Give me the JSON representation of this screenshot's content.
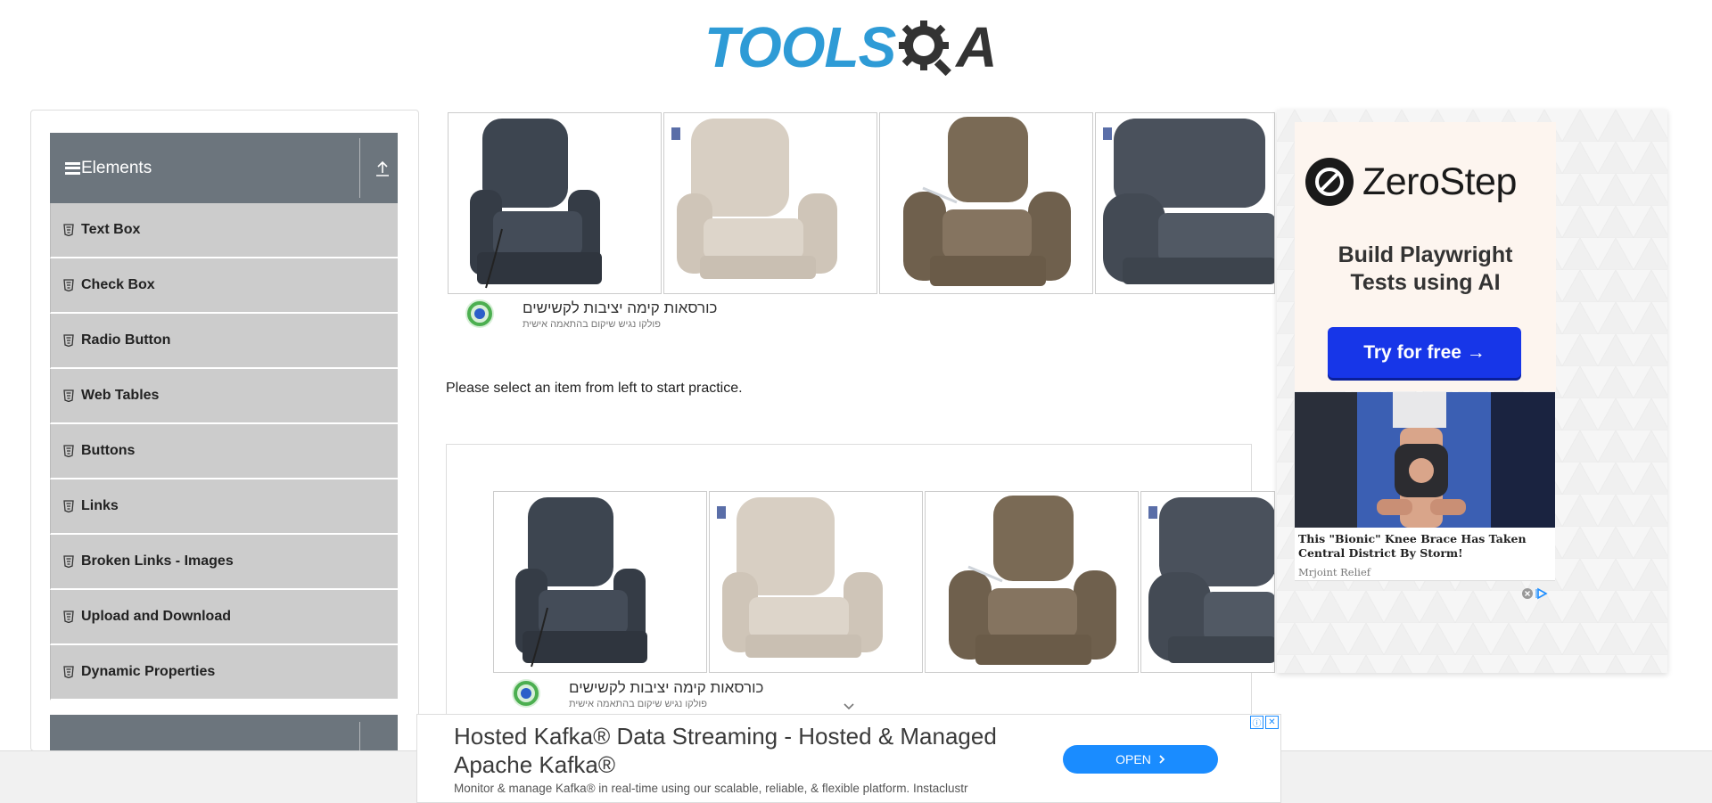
{
  "header": {
    "logo_main": "TOOLS",
    "logo_tail": "A"
  },
  "sidebar": {
    "group_title": "Elements",
    "items": [
      {
        "label": "Text Box"
      },
      {
        "label": "Check Box"
      },
      {
        "label": "Radio Button"
      },
      {
        "label": "Web Tables"
      },
      {
        "label": "Buttons"
      },
      {
        "label": "Links"
      },
      {
        "label": "Broken Links - Images"
      },
      {
        "label": "Upload and Download"
      },
      {
        "label": "Dynamic Properties"
      }
    ]
  },
  "top_ad": {
    "title": "כורסאות קימה יציבות לקשישים",
    "subtitle": "פולקו נגיש שיקום בהתאמה אישית"
  },
  "main": {
    "practice_text": "Please select an item from left to start practice."
  },
  "inner_ad": {
    "title": "כורסאות קימה יציבות לקשישים",
    "subtitle": "פולקו נגיש שיקום בהתאמה אישית"
  },
  "right_ad": {
    "brand": "ZeroStep",
    "headline_line1": "Build Playwright",
    "headline_line2": "Tests using AI",
    "cta": "Try for free →",
    "knee_title": "This \"Bionic\" Knee Brace Has Taken Central District By Storm!",
    "knee_source": "Mrjoint Relief"
  },
  "bottom_ad": {
    "title": "Hosted Kafka® Data Streaming - Hosted & Managed Apache Kafka®",
    "description": "Monitor & manage Kafka® in real-time using our scalable, reliable, & flexible platform. Instaclustr",
    "cta": "OPEN",
    "info_badge": "ⓘ",
    "close_badge": "✕"
  },
  "colors": {
    "sidebar_header": "#6c757d",
    "menu_item": "#cccccc",
    "logo_blue": "#2e9bd6",
    "zerostep_button": "#1736e8",
    "open_button": "#1a8cff"
  },
  "icons": {
    "menu_hamburger": "hamburger-icon",
    "collapse": "collapse-up-icon",
    "menu_item": "html5-badge-icon",
    "gear": "gear-magnifier-icon",
    "chevron": "chevron-down-icon"
  }
}
